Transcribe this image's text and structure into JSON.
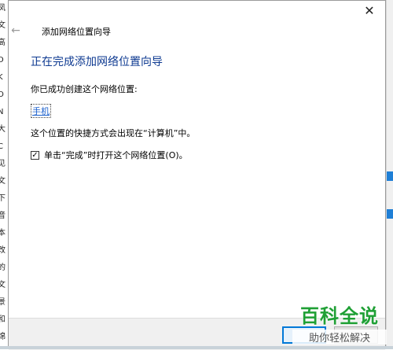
{
  "window": {
    "title": "添加网络位置向导",
    "close_glyph": "✕",
    "back_glyph": "←"
  },
  "content": {
    "heading": "正在完成添加网络位置向导",
    "created_label": "你已成功创建这个网络位置:",
    "location_name": "手机",
    "shortcut_note": "这个位置的快捷方式会出现在“计算机”中。",
    "open_checkbox": {
      "label": "单击“完成”时打开这个网络位置(O)。",
      "checked": true,
      "check_glyph": "✓"
    }
  },
  "background_strip": [
    "凤",
    "文",
    "高",
    "D",
    "K",
    "O",
    "N",
    "大",
    "C",
    "见",
    "文",
    "下",
    "音",
    "本",
    "改",
    "的",
    "文",
    "景",
    "和",
    "绵"
  ],
  "watermark": {
    "main": "百科全说",
    "sub": "助你轻松解决"
  },
  "colors": {
    "heading": "#0e3a91",
    "link": "#1a5fcc",
    "watermark": "#1fa035",
    "footer": "#f0f0f0",
    "accent": "#0078d7"
  }
}
